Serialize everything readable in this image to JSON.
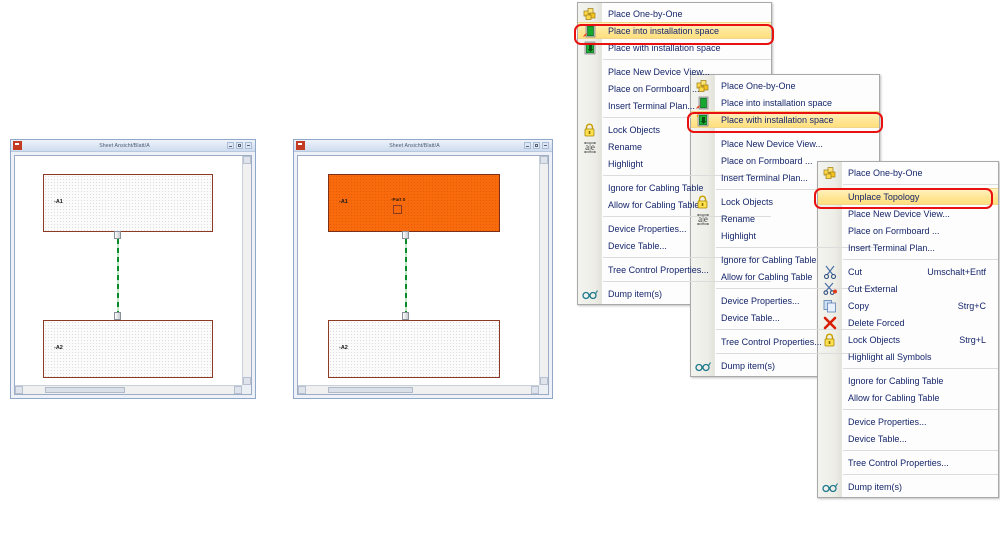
{
  "windows": [
    {
      "name": "left-sheet-window",
      "title": "Sheet Ansicht/Blatt/A",
      "boxes": [
        {
          "label": "-A1",
          "highlighted": false
        },
        {
          "label": "-A2",
          "highlighted": false
        }
      ]
    },
    {
      "name": "right-sheet-window",
      "title": "Sheet Ansicht/Blatt/A",
      "boxes": [
        {
          "label": "-A1",
          "sublabel": "-Part 0",
          "highlighted": true
        },
        {
          "label": "-A2",
          "highlighted": false
        }
      ]
    }
  ],
  "window_buttons": {
    "minimize": "Minimize",
    "maximize": "Maximize",
    "close": "Close"
  },
  "menu1": {
    "items": [
      {
        "label": "Place One-by-One",
        "icon": "cubes-icon",
        "accel": "",
        "highlight": "none"
      },
      {
        "label": "Place into installation space",
        "icon": "place-into-icon",
        "accel": "",
        "highlight": "full"
      },
      {
        "label": "Place with installation space",
        "icon": "place-with-icon",
        "accel": "",
        "highlight": "none"
      },
      {
        "sep": true
      },
      {
        "label": "Place New Device View...",
        "icon": "",
        "accel": "",
        "highlight": "none"
      },
      {
        "label": "Place on Formboard ...",
        "icon": "",
        "accel": "",
        "highlight": "none"
      },
      {
        "label": "Insert Terminal Plan...",
        "icon": "",
        "accel": "",
        "highlight": "none"
      },
      {
        "sep": true
      },
      {
        "label": "Lock Objects",
        "icon": "lock-icon",
        "accel": "",
        "highlight": "none"
      },
      {
        "label": "Rename",
        "icon": "rename-icon",
        "accel": "",
        "highlight": "none"
      },
      {
        "label": "Highlight",
        "icon": "",
        "accel": "",
        "highlight": "none"
      },
      {
        "sep": true
      },
      {
        "label": "Ignore for Cabling Table",
        "icon": "",
        "accel": "",
        "highlight": "none"
      },
      {
        "label": "Allow for Cabling Table",
        "icon": "",
        "accel": "",
        "highlight": "none"
      },
      {
        "sep": true
      },
      {
        "label": "Device Properties...",
        "icon": "",
        "accel": "",
        "highlight": "none"
      },
      {
        "label": "Device Table...",
        "icon": "",
        "accel": "",
        "highlight": "none"
      },
      {
        "sep": true
      },
      {
        "label": "Tree Control Properties...",
        "icon": "",
        "accel": "",
        "highlight": "none"
      },
      {
        "sep": true
      },
      {
        "label": "Dump item(s)",
        "icon": "glasses-icon",
        "accel": "",
        "highlight": "none"
      }
    ]
  },
  "menu2": {
    "items": [
      {
        "label": "Place One-by-One",
        "icon": "cubes-icon",
        "accel": "",
        "highlight": "none"
      },
      {
        "label": "Place into installation space",
        "icon": "place-into-icon",
        "accel": "",
        "highlight": "none"
      },
      {
        "label": "Place with installation space",
        "icon": "place-with-icon",
        "accel": "",
        "highlight": "full"
      },
      {
        "sep": true
      },
      {
        "label": "Place New Device View...",
        "icon": "",
        "accel": "",
        "highlight": "none"
      },
      {
        "label": "Place on Formboard ...",
        "icon": "",
        "accel": "",
        "highlight": "none"
      },
      {
        "label": "Insert Terminal Plan...",
        "icon": "",
        "accel": "",
        "highlight": "none"
      },
      {
        "sep": true
      },
      {
        "label": "Lock Objects",
        "icon": "lock-icon",
        "accel": "",
        "highlight": "none"
      },
      {
        "label": "Rename",
        "icon": "rename-icon",
        "accel": "",
        "highlight": "none"
      },
      {
        "label": "Highlight",
        "icon": "",
        "accel": "",
        "highlight": "none"
      },
      {
        "sep": true
      },
      {
        "label": "Ignore for Cabling Table",
        "icon": "",
        "accel": "",
        "highlight": "none"
      },
      {
        "label": "Allow for Cabling Table",
        "icon": "",
        "accel": "",
        "highlight": "none"
      },
      {
        "sep": true
      },
      {
        "label": "Device Properties...",
        "icon": "",
        "accel": "",
        "highlight": "none"
      },
      {
        "label": "Device Table...",
        "icon": "",
        "accel": "",
        "highlight": "none"
      },
      {
        "sep": true
      },
      {
        "label": "Tree Control Properties...",
        "icon": "",
        "accel": "",
        "highlight": "none"
      },
      {
        "sep": true
      },
      {
        "label": "Dump item(s)",
        "icon": "glasses-icon",
        "accel": "",
        "highlight": "none"
      }
    ]
  },
  "menu3": {
    "items": [
      {
        "label": "Place One-by-One",
        "icon": "cubes-icon",
        "accel": "",
        "highlight": "none"
      },
      {
        "sep": true
      },
      {
        "label": "Unplace Topology",
        "icon": "",
        "accel": "",
        "highlight": "full"
      },
      {
        "label": "Place New Device View...",
        "icon": "",
        "accel": "",
        "highlight": "none"
      },
      {
        "label": "Place on Formboard ...",
        "icon": "",
        "accel": "",
        "highlight": "none"
      },
      {
        "label": "Insert Terminal Plan...",
        "icon": "",
        "accel": "",
        "highlight": "none"
      },
      {
        "sep": true
      },
      {
        "label": "Cut",
        "icon": "scissors-icon",
        "accel": "Umschalt+Entf",
        "highlight": "none"
      },
      {
        "label": "Cut External",
        "icon": "cut-external-icon",
        "accel": "",
        "highlight": "none"
      },
      {
        "label": "Copy",
        "icon": "copy-icon",
        "accel": "Strg+C",
        "highlight": "none"
      },
      {
        "label": "Delete Forced",
        "icon": "delete-icon",
        "accel": "",
        "highlight": "none"
      },
      {
        "label": "Lock Objects",
        "icon": "lock-icon",
        "accel": "Strg+L",
        "highlight": "none"
      },
      {
        "label": "Highlight all Symbols",
        "icon": "",
        "accel": "",
        "highlight": "none"
      },
      {
        "sep": true
      },
      {
        "label": "Ignore for Cabling Table",
        "icon": "",
        "accel": "",
        "highlight": "none"
      },
      {
        "label": "Allow for Cabling Table",
        "icon": "",
        "accel": "",
        "highlight": "none"
      },
      {
        "sep": true
      },
      {
        "label": "Device Properties...",
        "icon": "",
        "accel": "",
        "highlight": "none"
      },
      {
        "label": "Device Table...",
        "icon": "",
        "accel": "",
        "highlight": "none"
      },
      {
        "sep": true
      },
      {
        "label": "Tree Control Properties...",
        "icon": "",
        "accel": "",
        "highlight": "none"
      },
      {
        "sep": true
      },
      {
        "label": "Dump item(s)",
        "icon": "glasses-icon",
        "accel": "",
        "highlight": "none"
      }
    ]
  },
  "colors": {
    "highlight_box_border": "#e8110f",
    "menu_highlight": "#ffe79a",
    "device_box_border": "#8c3a22",
    "device_box_selected": "#f96a0c",
    "connector_green": "#0b8a2a",
    "menu_text": "#16266b"
  }
}
